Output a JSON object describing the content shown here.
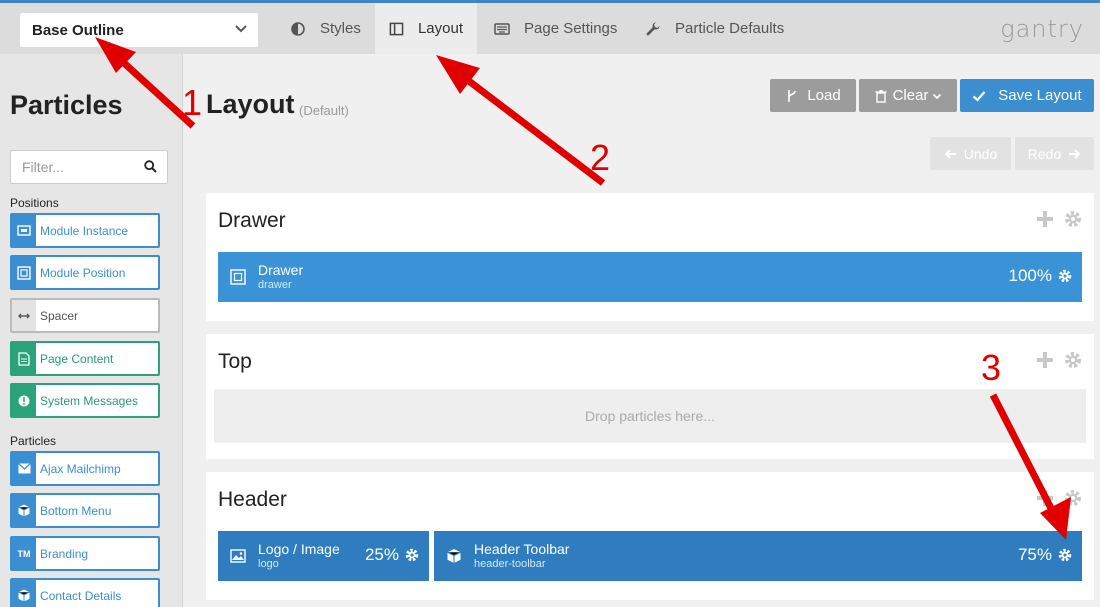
{
  "topbar": {
    "outline_select": "Base Outline",
    "tabs": [
      {
        "label": "Styles",
        "icon": "contrast-icon"
      },
      {
        "label": "Layout",
        "icon": "columns-icon"
      },
      {
        "label": "Page Settings",
        "icon": "keyboard-icon"
      },
      {
        "label": "Particle Defaults",
        "icon": "wrench-icon"
      }
    ],
    "active_tab": "Layout",
    "brand": "gantry"
  },
  "sidebar": {
    "title": "Particles",
    "filter_placeholder": "Filter...",
    "positions_label": "Positions",
    "positions": [
      {
        "label": "Module Instance",
        "icon": "module-instance-icon"
      },
      {
        "label": "Module Position",
        "icon": "module-position-icon"
      },
      {
        "label": "Spacer",
        "icon": "arrows-horizontal-icon"
      },
      {
        "label": "Page Content",
        "icon": "document-icon"
      },
      {
        "label": "System Messages",
        "icon": "info-icon"
      }
    ],
    "particles_label": "Particles",
    "particles": [
      {
        "label": "Ajax Mailchimp",
        "icon": "envelope-icon"
      },
      {
        "label": "Bottom Menu",
        "icon": "cube-icon"
      },
      {
        "label": "Branding",
        "icon": "tm-icon",
        "glyph": "TM"
      },
      {
        "label": "Contact Details",
        "icon": "cube-icon"
      }
    ]
  },
  "main": {
    "title": "Layout",
    "subtitle": "(Default)",
    "buttons": {
      "load": "Load",
      "clear": "Clear",
      "save": "Save Layout",
      "undo": "Undo",
      "redo": "Redo"
    },
    "sections": {
      "drawer": {
        "name": "Drawer",
        "block": {
          "name": "Drawer",
          "sub": "drawer",
          "pct": "100%"
        }
      },
      "top": {
        "name": "Top",
        "drop_text": "Drop particles here..."
      },
      "header": {
        "name": "Header",
        "blocks": [
          {
            "name": "Logo / Image",
            "sub": "logo",
            "pct": "25%"
          },
          {
            "name": "Header Toolbar",
            "sub": "header-toolbar",
            "pct": "75%"
          }
        ]
      }
    }
  },
  "annotations": {
    "labels": [
      "1",
      "2",
      "3"
    ],
    "color": "#e00000"
  },
  "colors": {
    "accent": "#3b8fd0",
    "green": "#2aa37a",
    "annotation": "#e00000"
  }
}
